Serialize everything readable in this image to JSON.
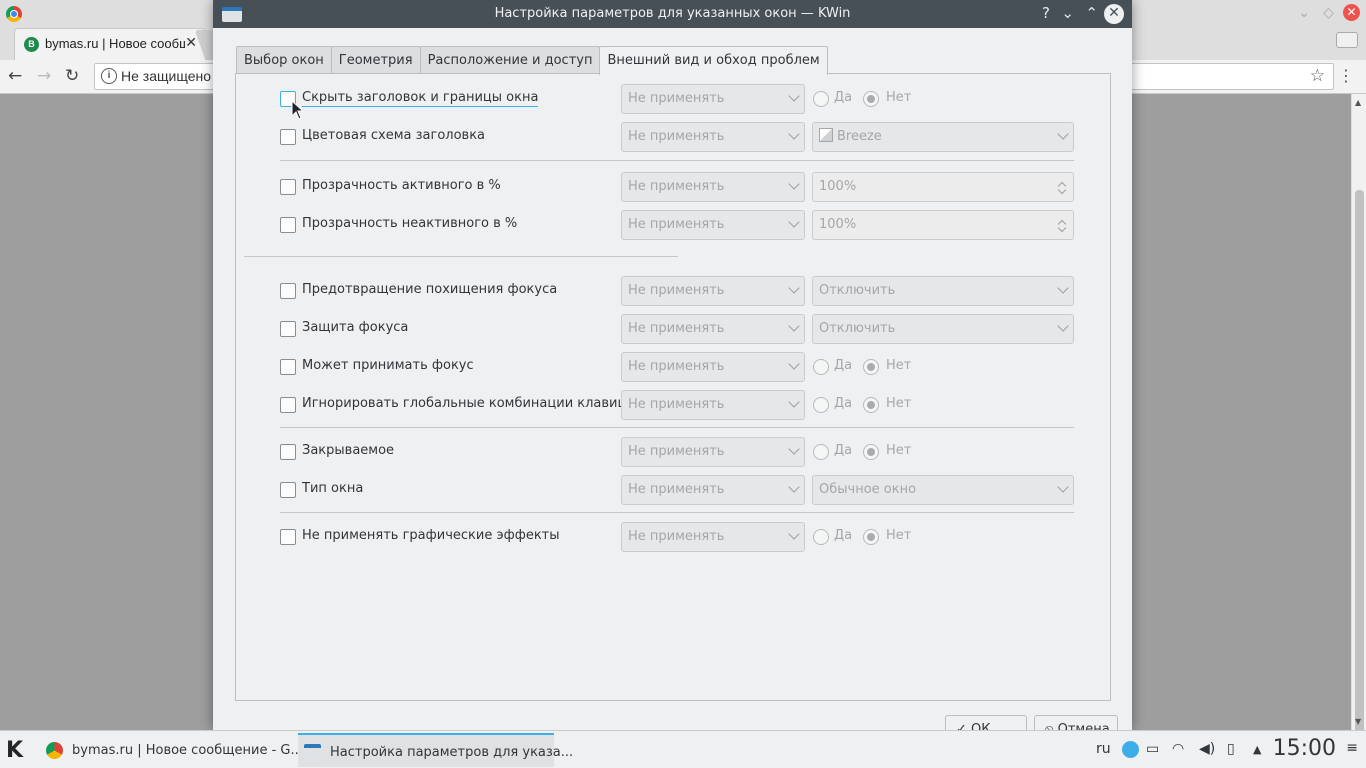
{
  "browser": {
    "tab_title": "bymas.ru | Новое сообщение",
    "address": "Не защищено",
    "tab_favicon_letter": "B"
  },
  "dialog": {
    "title": "Настройка параметров для указанных окон — KWin",
    "tabs": [
      {
        "label": "Выбор окон",
        "active": false
      },
      {
        "label": "Геометрия",
        "active": false
      },
      {
        "label": "Расположение и доступ",
        "active": false
      },
      {
        "label": "Внешний вид и обход проблем",
        "active": true
      }
    ],
    "rows": [
      {
        "label": "Скрыть заголовок и границы окна",
        "policy": "Не применять",
        "yes": "Да",
        "no": "Нет"
      },
      {
        "label": "Цветовая схема заголовка",
        "policy": "Не применять",
        "value": "Breeze"
      },
      {
        "label": "Прозрачность активного в %",
        "policy": "Не применять",
        "value": "100%"
      },
      {
        "label": "Прозрачность неактивного в %",
        "policy": "Не применять",
        "value": "100%"
      },
      {
        "label": "Предотвращение похищения фокуса",
        "policy": "Не применять",
        "value": "Отключить"
      },
      {
        "label": "Защита фокуса",
        "policy": "Не применять",
        "value": "Отключить"
      },
      {
        "label": "Может принимать фокус",
        "policy": "Не применять",
        "yes": "Да",
        "no": "Нет"
      },
      {
        "label": "Игнорировать глобальные комбинации клавиш",
        "policy": "Не применять",
        "yes": "Да",
        "no": "Нет"
      },
      {
        "label": "Закрываемое",
        "policy": "Не применять",
        "yes": "Да",
        "no": "Нет"
      },
      {
        "label": "Тип окна",
        "policy": "Не применять",
        "value": "Обычное окно"
      },
      {
        "label": "Не применять графические эффекты",
        "policy": "Не применять",
        "yes": "Да",
        "no": "Нет"
      }
    ],
    "buttons": {
      "ok": "ОК",
      "cancel": "Отмена"
    }
  },
  "taskbar": {
    "tasks": [
      {
        "label": "bymas.ru | Новое сообщение - G..."
      },
      {
        "label": "Настройка параметров для указа..."
      }
    ],
    "lang": "ru",
    "clock": "15:00"
  },
  "colors": {
    "accent": "#3daee9",
    "titlebar": "#475057",
    "window_bg": "#eff0f1"
  }
}
